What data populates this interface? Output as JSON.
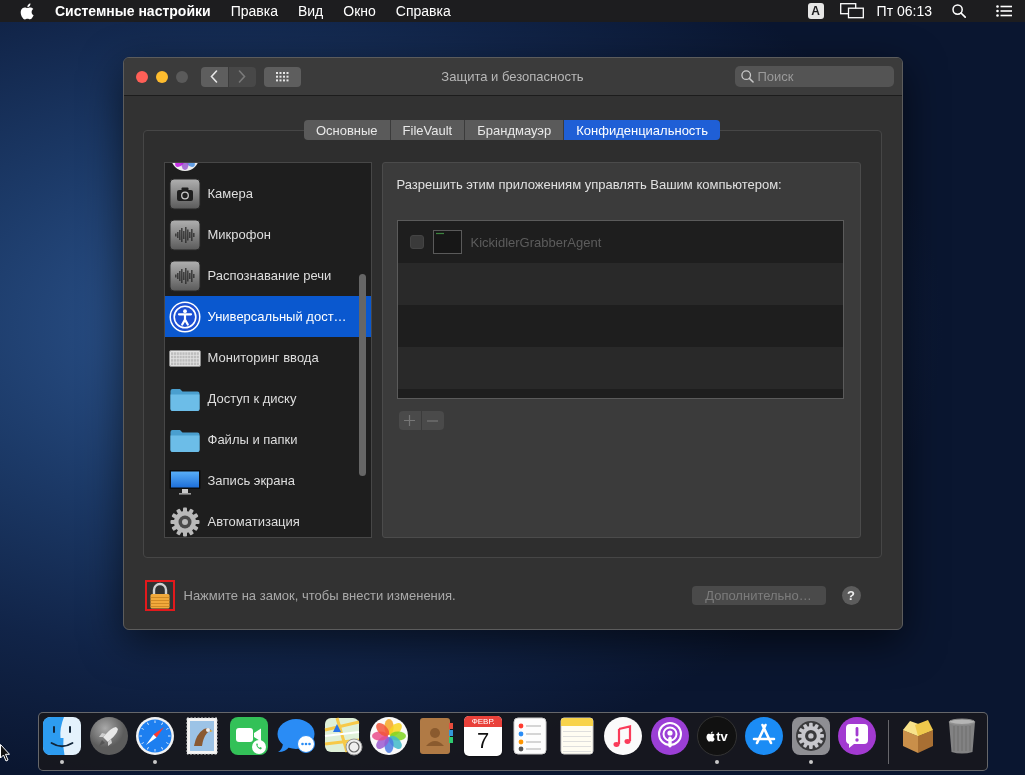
{
  "menu_bar": {
    "app_name": "Системные настройки",
    "items": [
      "Правка",
      "Вид",
      "Окно",
      "Справка"
    ],
    "input_source": "A",
    "clock": "Пт 06:13"
  },
  "window": {
    "title": "Защита и безопасность",
    "controls": [
      {
        "kind": "close",
        "disabled": false
      },
      {
        "kind": "minimize",
        "disabled": false
      },
      {
        "kind": "zoom",
        "disabled": true
      }
    ],
    "nav": [
      {
        "kind": "back",
        "disabled": false
      },
      {
        "kind": "forward",
        "disabled": true
      }
    ],
    "search": {
      "placeholder": "Поиск"
    }
  },
  "tabs": [
    {
      "label": "Основные",
      "selected": false
    },
    {
      "label": "FileVault",
      "selected": false
    },
    {
      "label": "Брандмауэр",
      "selected": false
    },
    {
      "label": "Конфиденциальность",
      "selected": true
    }
  ],
  "sidebar": {
    "items": [
      {
        "kind": "photos",
        "selected": false
      },
      {
        "kind": "camera",
        "label": "Камера",
        "selected": false
      },
      {
        "kind": "microphone",
        "label": "Микрофон",
        "selected": false
      },
      {
        "kind": "speech",
        "label": "Распознавание речи",
        "selected": false
      },
      {
        "kind": "accessibility",
        "label": "Универсальный дост…",
        "selected": true
      },
      {
        "kind": "keyboard",
        "label": "Мониторинг ввода",
        "selected": false
      },
      {
        "kind": "folder",
        "label": "Доступ к диску",
        "selected": false
      },
      {
        "kind": "folder",
        "label": "Файлы и папки",
        "selected": false
      },
      {
        "kind": "display",
        "label": "Запись экрана",
        "selected": false
      },
      {
        "kind": "automation",
        "label": "Автоматизация",
        "selected": false
      }
    ]
  },
  "privacy_panel": {
    "heading": "Разрешить этим приложениям управлять Вашим компьютером:",
    "apps": [
      {
        "name": "KickidlerGrabberAgent",
        "checked": false,
        "disabled": true
      }
    ],
    "buttons": [
      {
        "kind": "add",
        "disabled": true
      },
      {
        "kind": "remove",
        "disabled": true
      }
    ]
  },
  "footer": {
    "lock": {
      "locked": true,
      "highlighted": true
    },
    "message": "Нажмите на замок, чтобы внести изменения.",
    "advanced_button": {
      "label": "Дополнительно…",
      "disabled": true
    },
    "help": "?"
  },
  "dock": {
    "items": [
      {
        "kind": "finder",
        "running": true
      },
      {
        "kind": "launchpad",
        "running": false
      },
      {
        "kind": "safari",
        "running": true
      },
      {
        "kind": "mail",
        "running": false
      },
      {
        "kind": "facetime",
        "running": false
      },
      {
        "kind": "messages",
        "running": false
      },
      {
        "kind": "maps",
        "running": false
      },
      {
        "kind": "photos",
        "running": false
      },
      {
        "kind": "contacts",
        "running": false
      },
      {
        "kind": "calendar",
        "running": false,
        "month": "ФЕВР.",
        "day": "7"
      },
      {
        "kind": "reminders",
        "running": false
      },
      {
        "kind": "notes",
        "running": false
      },
      {
        "kind": "music",
        "running": false
      },
      {
        "kind": "podcasts",
        "running": false
      },
      {
        "kind": "tv",
        "running": true,
        "label": "tv"
      },
      {
        "kind": "appstore",
        "running": false
      },
      {
        "kind": "preferences",
        "running": true
      },
      {
        "kind": "feedback",
        "running": false
      },
      {
        "kind": "separator"
      },
      {
        "kind": "archive",
        "running": false
      },
      {
        "kind": "trash",
        "running": false
      }
    ]
  }
}
